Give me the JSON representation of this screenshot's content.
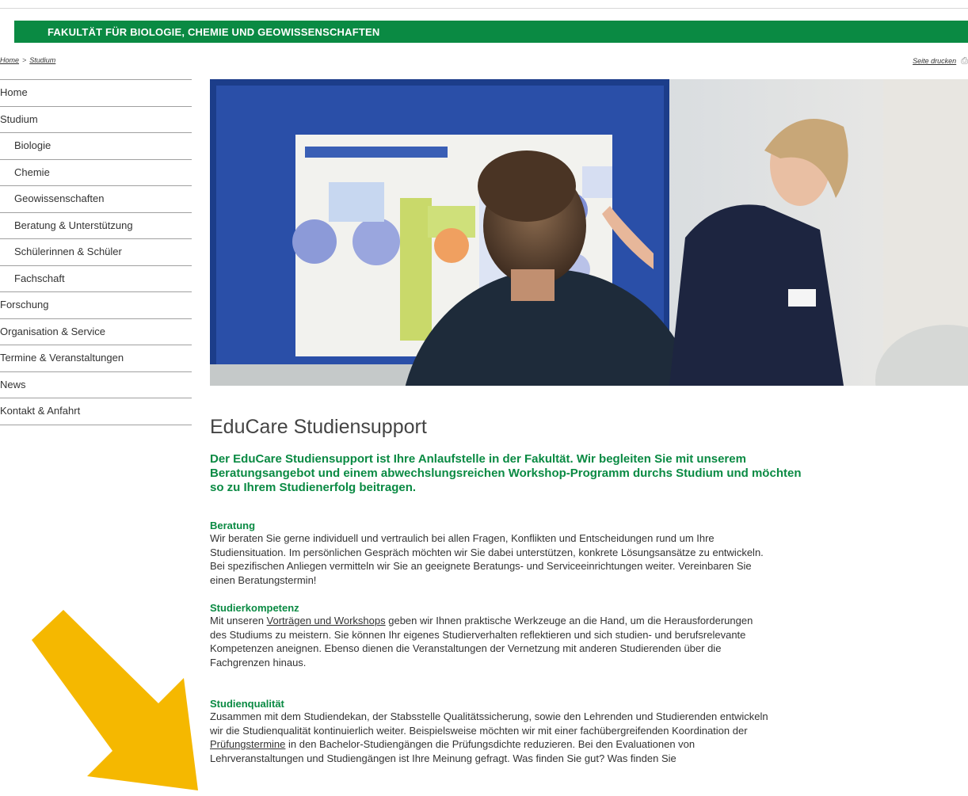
{
  "banner": {
    "title": "FAKULTÄT FÜR BIOLOGIE, CHEMIE UND GEOWISSENSCHAFTEN"
  },
  "breadcrumb": {
    "home": "Home",
    "separator": ">",
    "current": "Studium"
  },
  "print": {
    "label": "Seite drucken"
  },
  "sidebar": {
    "items": [
      {
        "label": "Home"
      },
      {
        "label": "Studium"
      },
      {
        "label": "Biologie"
      },
      {
        "label": "Chemie"
      },
      {
        "label": "Geowissenschaften"
      },
      {
        "label": "Beratung & Unterstützung"
      },
      {
        "label": "Schülerinnen & Schüler"
      },
      {
        "label": "Fachschaft"
      },
      {
        "label": "Forschung"
      },
      {
        "label": "Organisation & Service"
      },
      {
        "label": "Termine & Veranstaltungen"
      },
      {
        "label": "News"
      },
      {
        "label": "Kontakt & Anfahrt"
      }
    ]
  },
  "main": {
    "title": "EduCare Studiensupport",
    "lead": [
      "Der EduCare Studiensupport ist Ihre Anlaufstelle in der Fakultät. Wir begleiten Sie mit unserem",
      "Beratungsangebot und einem abwechslungsreichen Workshop-Programm durchs Studium und möchten",
      "so zu Ihrem Studienerfolg beitragen."
    ],
    "sections": [
      {
        "heading": "Beratung",
        "lines": [
          "Wir beraten Sie gerne individuell und vertraulich bei allen Fragen, Konflikten und Entscheidungen rund um Ihre",
          "Studiensituation. Im persönlichen Gespräch möchten wir Sie dabei unterstützen, konkrete Lösungsansätze zu entwickeln.",
          "Bei spezifischen Anliegen vermitteln wir Sie an geeignete Beratungs- und Serviceeinrichtungen weiter. Vereinbaren Sie",
          "einen Beratungstermin!"
        ]
      },
      {
        "heading": "Studierkompetenz",
        "line1_pre": "Mit unseren ",
        "line1_link": "Vorträgen und Workshops",
        "line1_post": " geben wir Ihnen praktische Werkzeuge an die Hand, um die Herausforderungen",
        "lines": [
          "des Studiums zu meistern. Sie können Ihr eigenes Studierverhalten reflektieren und sich studien- und berufsrelevante",
          "Kompetenzen aneignen. Ebenso dienen die Veranstaltungen der Vernetzung mit anderen Studierenden über die",
          "Fachgrenzen hinaus."
        ]
      },
      {
        "heading": "Studienqualität",
        "lines": [
          "Zusammen mit dem Studiendekan, der Stabsstelle Qualitätssicherung, sowie den Lehrenden und Studierenden entwickeln",
          "wir die Studienqualität kontinuierlich weiter. Beispielsweise möchten wir mit einer fachübergreifenden Koordination der"
        ],
        "line3_link": "Prüfungstermine",
        "line3_post": " in den Bachelor-Studiengängen die Prüfungsdichte reduzieren. Bei den Evaluationen von",
        "line4": "Lehrveranstaltungen und Studiengängen ist Ihre Meinung gefragt. Was finden Sie gut? Was finden Sie"
      }
    ]
  },
  "colors": {
    "brand_green": "#0a8a43",
    "arrow_yellow": "#f5b800"
  },
  "icons": {
    "print": "printer-icon",
    "annotation": "arrow-pointer-icon"
  }
}
